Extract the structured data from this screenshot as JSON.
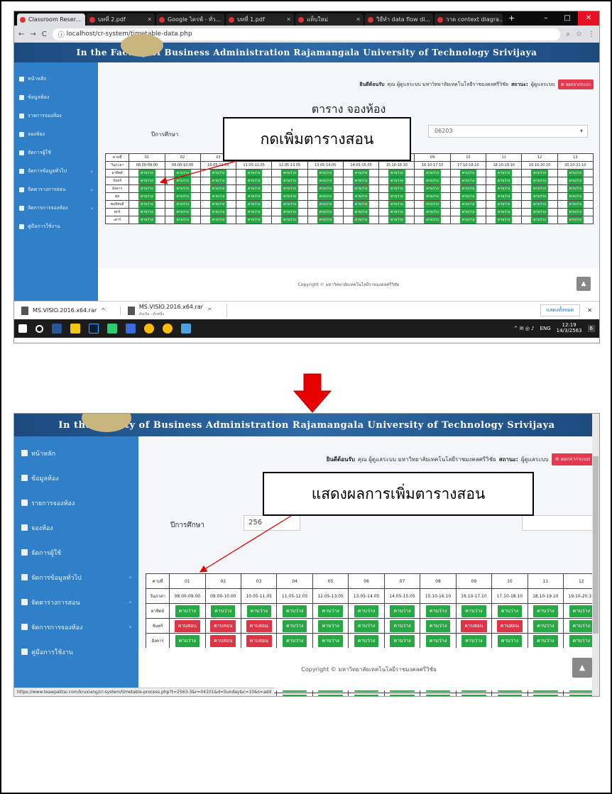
{
  "browser": {
    "tabs": [
      {
        "label": "Classroom Reser...",
        "active": true
      },
      {
        "label": "บทที่ 2.pdf",
        "active": false
      },
      {
        "label": "Google ไดรฟ์ - ทั่ว...",
        "active": false
      },
      {
        "label": "บทที่ 1.pdf",
        "active": false
      },
      {
        "label": "แท็บใหม่",
        "active": false
      },
      {
        "label": "วิธีทำ data flow di...",
        "active": false
      },
      {
        "label": "วาด context diagra...",
        "active": false
      }
    ],
    "new_tab": "+",
    "url": "localhost/cr-system/timetable-data.php"
  },
  "header_banner": "In the Faculty of Business Administration Rajamangala University of Technology Srivijaya",
  "sidebar": {
    "items": [
      {
        "label": "หน้าหลัก",
        "icon": "home-icon",
        "chevron": false
      },
      {
        "label": "ข้อมูลห้อง",
        "icon": "database-icon",
        "chevron": false
      },
      {
        "label": "รายการจองห้อง",
        "icon": "pencil-icon",
        "chevron": false
      },
      {
        "label": "จองห้อง",
        "icon": "pencil-icon",
        "chevron": false
      },
      {
        "label": "จัดการผู้ใช้",
        "icon": "user-icon",
        "chevron": false
      },
      {
        "label": "จัดการข้อมูลทั่วไป",
        "icon": "gears-icon",
        "chevron": true
      },
      {
        "label": "จัดตารางการสอน",
        "icon": "edit-icon",
        "chevron": true
      },
      {
        "label": "จัดการการจองห้อง",
        "icon": "sitemap-icon",
        "chevron": true
      },
      {
        "label": "คู่มือการใช้งาน",
        "icon": "book-icon",
        "chevron": false
      }
    ]
  },
  "welcome": {
    "greeting": "ยินดีต้อนรับ",
    "user_text": "คุณ ผู้ดูแลระบบ มหาวิทยาลัยเทคโนโลยีราชมงคลศรีวิชัย",
    "status_label": "สถานะ:",
    "status_value": "ผู้ดูแลระบบ",
    "logout": "ออกจากระบบ"
  },
  "page_title": "ตาราง จองห้อง",
  "form": {
    "year_label": "ปีการศึกษา",
    "year_value_partial": "256",
    "room_value": "06203"
  },
  "timetable": {
    "period_header": "คาบที่",
    "time_header": "วัน/เวลา",
    "periods": [
      "01",
      "02",
      "03",
      "04",
      "05",
      "06",
      "07",
      "08",
      "09",
      "10",
      "11",
      "12",
      "13"
    ],
    "times": [
      "08.00-09.00",
      "09.00-10.00",
      "10.05-11.05",
      "11.05-12.05",
      "12.05-13.05",
      "13.05-14.05",
      "14.05-15.05",
      "15.10-16.10",
      "16.10-17.10",
      "17.10-18.10",
      "18.10-19.10",
      "19.10-20.10",
      "20.10-21.10"
    ],
    "days": [
      "อาทิตย์",
      "จันทร์",
      "อังคาร",
      "พุธ",
      "พฤหัสบดี",
      "ศุกร์",
      "เสาร์"
    ],
    "free_label": "คาบว่าง",
    "busy_label": "คาบสอน",
    "busy_after": [
      [],
      [
        0,
        1,
        2,
        8,
        9
      ],
      [
        1,
        2
      ],
      [
        1,
        2
      ],
      [
        0,
        1,
        2
      ],
      [],
      []
    ]
  },
  "footer": "Copyright © มหาวิทยาลัยเทคโนโลยีราชมงคลศรีวิชัย",
  "downloads": {
    "item1": "MS.VISIO.2016.x64.rar",
    "item2": "MS.VISIO.2016.x64.rar",
    "item2_sub": "ดับเบิล - ดับหนึ่ง",
    "show_all": "แสดงทั้งหมด"
  },
  "taskbar": {
    "lang": "ENG",
    "time": "12:19",
    "date": "14/3/2563",
    "notif_count": "6"
  },
  "callouts": {
    "before": "กดเพิ่มตารางสอน",
    "after": "แสดงผลการเพิ่มตารางสอน"
  },
  "status_url": "https://www.teawpaktai.com/kruxiang/cr-system/timetable-process.php?t=2563-3&r=04101&d=Sunday&c=10&s=add",
  "colors": {
    "sidebar": "#2f80c9",
    "free": "#28a745",
    "busy": "#dc3545",
    "arrow": "#e60000",
    "header": "#1c4a7d"
  }
}
